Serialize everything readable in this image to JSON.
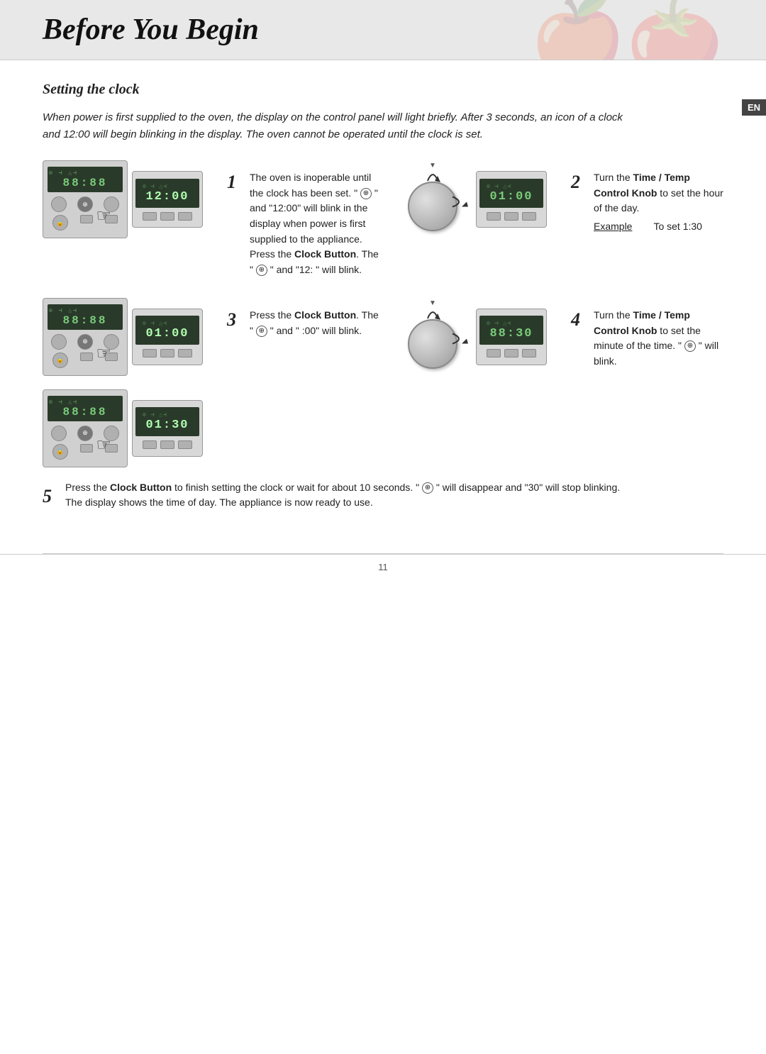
{
  "header": {
    "title": "Before You Begin",
    "en_label": "EN"
  },
  "section": {
    "title": "Setting the clock"
  },
  "intro": "When power is first supplied to the oven, the display on the control panel will light briefly. After 3 seconds, an icon of a clock and 12:00 will begin blinking in the display. The oven cannot be operated until the clock is set.",
  "steps": [
    {
      "number": "1",
      "text": "The oven is inoperable until the clock has been set. \" ⊕ \" and \"12:00\" will blink in the display when power is first supplied to the appliance. Press the Clock Button. The \" ⊕ \" and \"12: \" will blink.",
      "bold_parts": [
        "Clock Button"
      ]
    },
    {
      "number": "2",
      "text": "Turn the Time / Temp Control Knob to set the hour of the day.",
      "bold_parts": [
        "Time / Temp Control Knob"
      ],
      "example": true,
      "example_label": "Example",
      "example_value": "To set 1:30"
    },
    {
      "number": "3",
      "text": "Press the Clock Button. The \" ⊕ \" and \" :00\" will blink.",
      "bold_parts": [
        "Clock Button"
      ]
    },
    {
      "number": "4",
      "text": "Turn the Time / Temp Control Knob to set the minute of the time. \" ⊕ \" will blink.",
      "bold_parts": [
        "Time / Temp Control Knob"
      ]
    },
    {
      "number": "5",
      "text": "Press the Clock Button to finish setting the clock or wait for about 10 seconds. \" ⊕ \" will disappear and \"30\" will stop blinking. The display shows the time of day. The appliance is now ready to use.",
      "bold_parts": [
        "Clock Button"
      ]
    }
  ],
  "displays": {
    "step1_left": "88:88",
    "step1_right": "12:00",
    "step2_right": "01:00",
    "step3_left": "88:88",
    "step3_right": "01:00",
    "step4_right": "88:30",
    "step5_left": "88:88",
    "step5_right": "01:30"
  },
  "footer": {
    "page_number": "11"
  }
}
